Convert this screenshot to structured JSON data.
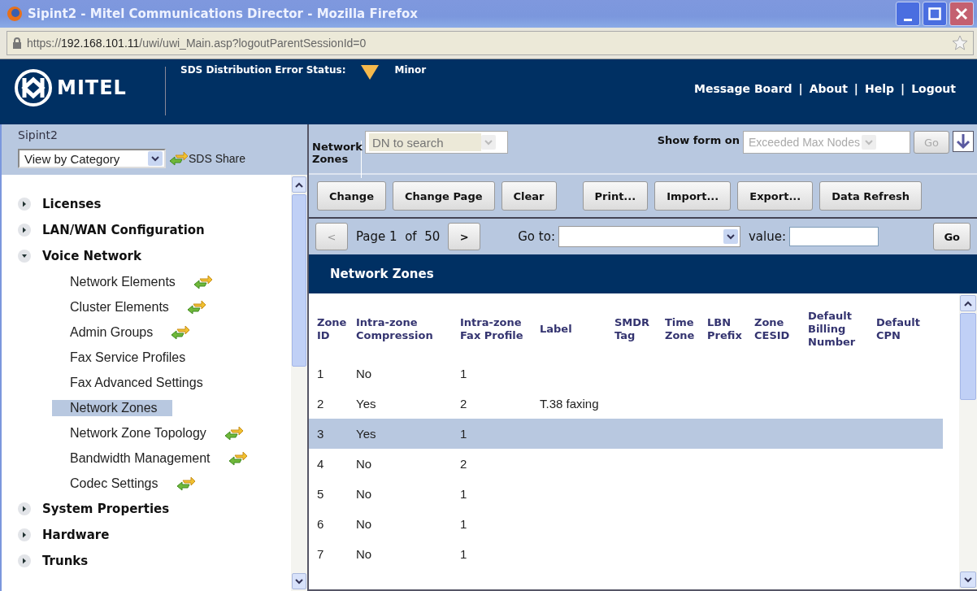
{
  "window": {
    "title": "Sipint2 - Mitel Communications Director - Mozilla Firefox"
  },
  "address_bar": {
    "prefix": "https://",
    "host": "192.168.101.11",
    "path": "/uwi/uwi_Main.asp?logoutParentSessionId=0"
  },
  "header": {
    "logo": "MITEL",
    "link_separator": "|",
    "status_label": "SDS Distribution Error Status:",
    "status_value": "Minor",
    "links": [
      "Message Board",
      "About",
      "Help",
      "Logout"
    ]
  },
  "sidebar": {
    "title": "Sipint2",
    "view_select": "View by Category",
    "share_label": "SDS Share",
    "items": [
      {
        "label": "Licenses",
        "expanded": false
      },
      {
        "label": "LAN/WAN Configuration",
        "expanded": false
      },
      {
        "label": "Voice Network",
        "expanded": true,
        "children": [
          {
            "label": "Network Elements",
            "shared": true,
            "selected": false
          },
          {
            "label": "Cluster Elements",
            "shared": true,
            "selected": false
          },
          {
            "label": "Admin Groups",
            "shared": true,
            "selected": false
          },
          {
            "label": "Fax Service Profiles",
            "shared": false,
            "selected": false
          },
          {
            "label": "Fax Advanced Settings",
            "shared": false,
            "selected": false
          },
          {
            "label": "Network Zones",
            "shared": false,
            "selected": true
          },
          {
            "label": "Network Zone Topology",
            "shared": true,
            "selected": false
          },
          {
            "label": "Bandwidth Management",
            "shared": true,
            "selected": false
          },
          {
            "label": "Codec Settings",
            "shared": true,
            "selected": false
          }
        ]
      },
      {
        "label": "System Properties",
        "expanded": false
      },
      {
        "label": "Hardware",
        "expanded": false
      },
      {
        "label": "Trunks",
        "expanded": false
      }
    ]
  },
  "toolbar": {
    "form_label": "Network Zones",
    "search_placeholder": "DN to search",
    "show_form_label": "Show form on",
    "show_form_value": "Exceeded Max Nodes",
    "go": "Go"
  },
  "actions": [
    "Change",
    "Change Page",
    "Clear",
    "Print...",
    "Import...",
    "Export...",
    "Data Refresh"
  ],
  "pager": {
    "prev": "<",
    "page": "Page 1",
    "of": "of",
    "total": "50",
    "next": ">",
    "goto_label": "Go to:",
    "value_label": "value:",
    "go": "Go"
  },
  "table": {
    "title": "Network Zones",
    "columns": [
      "Zone ID",
      "Intra-zone Compression",
      "Intra-zone Fax Profile",
      "Label",
      "SMDR Tag",
      "Time Zone",
      "LBN Prefix",
      "Zone CESID",
      "Default Billing Number",
      "Default CPN"
    ],
    "rows": [
      {
        "cells": [
          "1",
          "No",
          "1"
        ],
        "selected": false
      },
      {
        "cells": [
          "2",
          "Yes",
          "2",
          "T.38 faxing"
        ],
        "selected": false
      },
      {
        "cells": [
          "3",
          "Yes",
          "1"
        ],
        "selected": true
      },
      {
        "cells": [
          "4",
          "No",
          "2"
        ],
        "selected": false
      },
      {
        "cells": [
          "5",
          "No",
          "1"
        ],
        "selected": false
      },
      {
        "cells": [
          "6",
          "No",
          "1"
        ],
        "selected": false
      },
      {
        "cells": [
          "7",
          "No",
          "1"
        ],
        "selected": false
      }
    ]
  }
}
